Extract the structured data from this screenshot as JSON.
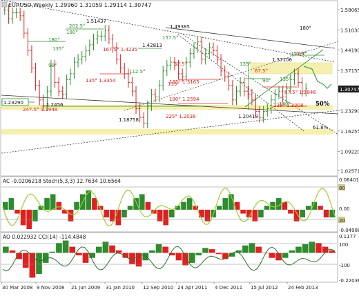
{
  "header": {
    "symbol_line": "EURUSD,Weekly  1.29960 1.31059 1.29114 1.30747"
  },
  "colors": {
    "up": "#2e8b2e",
    "down": "#e02020",
    "upper_line": "#9acd32",
    "fill_yellow": "#f6f0b0",
    "price_tag": "#1a1a1a"
  },
  "chart_data": [
    {
      "type": "line",
      "panel": "price",
      "x_labels": [
        "30 Mar 2008",
        "9 Nov 2008",
        "21 Jun 2009",
        "31 Jan 2010",
        "12 Sep 2010",
        "24 Apr 2011",
        "4 Dec 2011",
        "15 Jul 2012",
        "24 Feb 2013"
      ],
      "y_ticks": [
        "1.58065",
        "1.51030",
        "1.44190",
        "1.37155",
        "1.30747",
        "1.23290",
        "1.16255",
        "1.09220",
        "1.02571"
      ],
      "current_price": "1.30747",
      "ylim": [
        1.015,
        1.6
      ],
      "close": [
        1.58,
        1.55,
        1.57,
        1.57,
        1.56,
        1.5,
        1.44,
        1.38,
        1.32,
        1.27,
        1.25,
        1.3,
        1.39,
        1.33,
        1.3,
        1.29,
        1.34,
        1.36,
        1.4,
        1.41,
        1.42,
        1.44,
        1.46,
        1.48,
        1.49,
        1.49,
        1.51,
        1.48,
        1.45,
        1.41,
        1.38,
        1.36,
        1.33,
        1.3,
        1.24,
        1.21,
        1.19,
        1.25,
        1.29,
        1.28,
        1.32,
        1.37,
        1.39,
        1.4,
        1.39,
        1.36,
        1.35,
        1.4,
        1.43,
        1.45,
        1.47,
        1.41,
        1.43,
        1.45,
        1.44,
        1.41,
        1.37,
        1.35,
        1.32,
        1.27,
        1.3,
        1.33,
        1.3,
        1.29,
        1.27,
        1.23,
        1.21,
        1.23,
        1.24,
        1.27,
        1.29,
        1.3,
        1.28,
        1.31,
        1.34,
        1.36,
        1.33,
        1.3,
        1.31
      ],
      "labels": {
        "highs": [
          "1.51437",
          "1.49385",
          "1.42813",
          "1.37106"
        ],
        "lows": [
          "1.18758",
          "1.20418",
          "1.23290"
        ],
        "angles": [
          "180°",
          "202.5°",
          "180°",
          "135°",
          "90°",
          "157.5°",
          "112.5°",
          "135°",
          "67.5°",
          "180°",
          "225°",
          "135°",
          "90°",
          "67.5°",
          "135°",
          "180°",
          "157.5°"
        ],
        "levels": [
          "1.2456",
          "247.5° 1.1948",
          "167.5° 1.4235",
          "135° 1.3354",
          "135° 1.3165",
          "180° 1.2594",
          "225° 1.2038",
          "67.5° 1.2846",
          "135° 1.2008"
        ],
        "fib": [
          "50%",
          "61.8%"
        ]
      }
    },
    {
      "type": "bar",
      "panel": "AC_Stoch",
      "title": "AC -0.0206218  Stoch(5,3,3) 12.7634 10.6564",
      "y_ticks": [
        "0.064012",
        "80",
        "0.00",
        "20",
        "-0.04988"
      ],
      "values": [
        0.02,
        0.03,
        -0.01,
        -0.04,
        -0.05,
        -0.03,
        0.01,
        0.03,
        0.04,
        0.02,
        -0.01,
        -0.03,
        0.02,
        0.04,
        0.05,
        0.03,
        0.01,
        -0.02,
        -0.03,
        -0.04,
        -0.02,
        0.01,
        0.03,
        0.04,
        0.02,
        -0.01,
        -0.03,
        -0.04,
        -0.02,
        0.01,
        0.02,
        0.03,
        0.01,
        -0.02,
        -0.03,
        -0.02,
        0.01,
        0.03,
        0.04,
        0.02,
        -0.01,
        -0.02,
        -0.03,
        -0.02,
        0.01,
        0.02,
        0.03,
        0.02,
        -0.01,
        -0.03,
        -0.02,
        0.01,
        0.02,
        0.01,
        -0.02,
        -0.02
      ]
    },
    {
      "type": "bar",
      "panel": "AO_CCI",
      "title": "AO 0.022932  CCI(14) -114.4848",
      "y_ticks": [
        "0.1177",
        "100",
        "-100",
        "-0.22036"
      ],
      "values": [
        0.05,
        0.02,
        -0.05,
        -0.12,
        -0.2,
        -0.17,
        -0.08,
        0.01,
        0.08,
        0.1,
        0.05,
        -0.02,
        -0.08,
        -0.04,
        0.05,
        0.09,
        0.06,
        0.02,
        -0.04,
        -0.09,
        -0.11,
        -0.06,
        0.02,
        0.07,
        0.05,
        -0.02,
        -0.06,
        -0.1,
        -0.08,
        -0.02,
        0.04,
        0.03,
        -0.01,
        -0.05,
        -0.03,
        0.02,
        0.06,
        0.08,
        0.05,
        0.0,
        -0.04,
        -0.06,
        -0.04,
        0.02,
        0.05,
        0.07,
        0.09,
        0.08,
        0.05,
        0.02
      ]
    }
  ]
}
